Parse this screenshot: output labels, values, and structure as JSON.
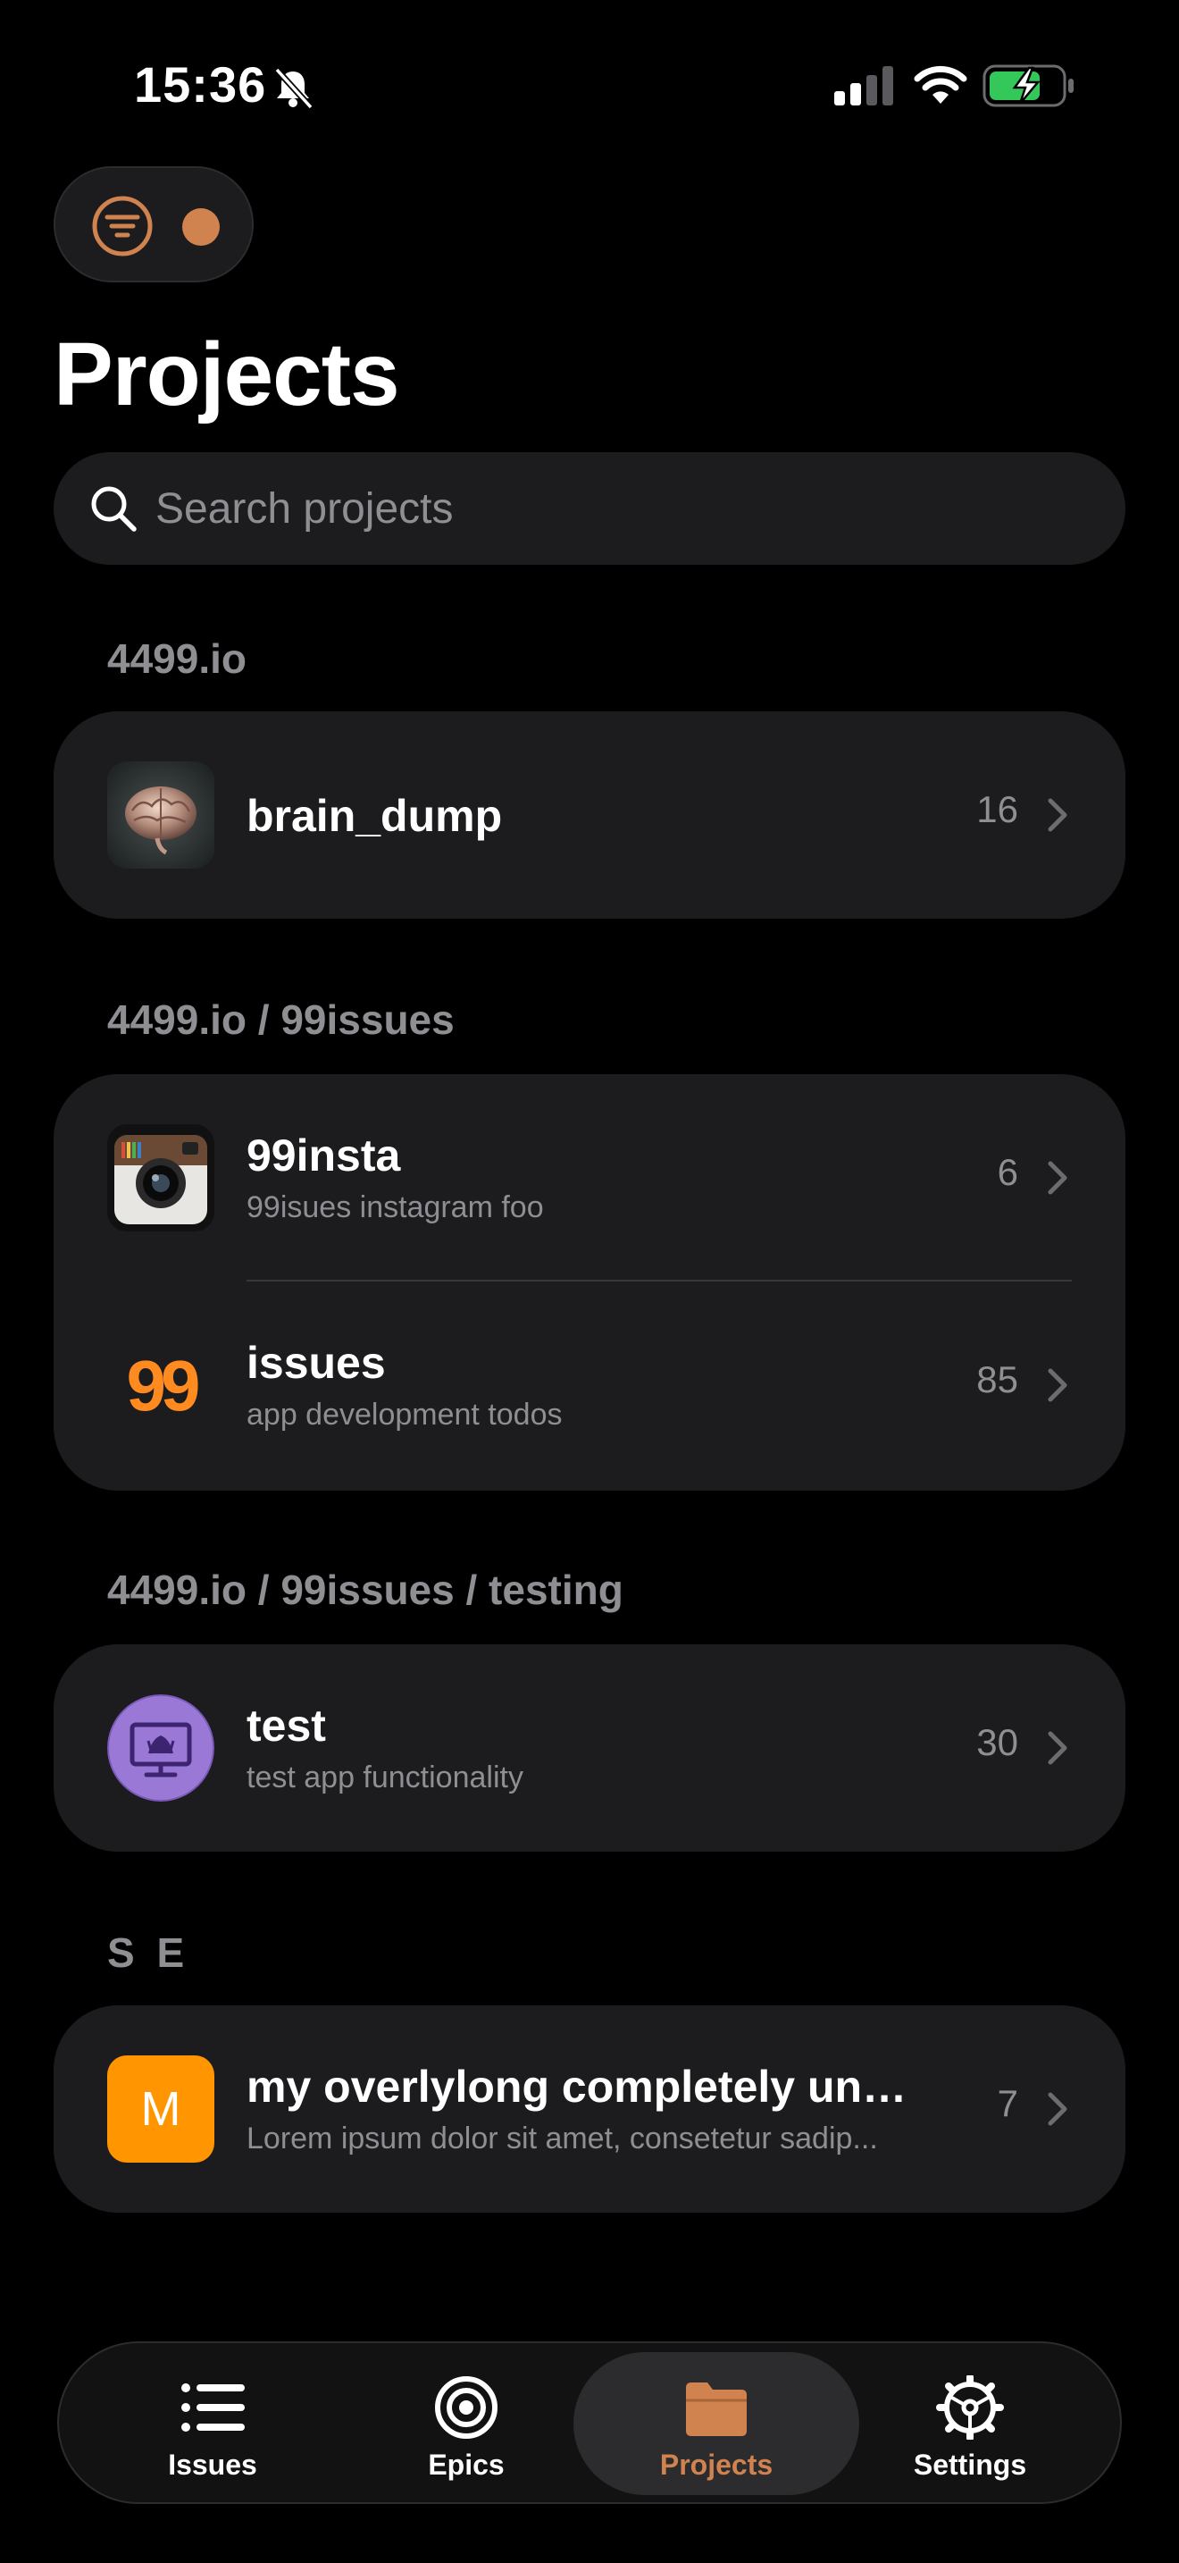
{
  "status_bar": {
    "time": "15:36"
  },
  "header": {
    "title": "Projects"
  },
  "search": {
    "placeholder": "Search projects"
  },
  "groups": [
    {
      "name": "4499.io",
      "projects": [
        {
          "name": "brain_dump",
          "description": "",
          "count": "16",
          "icon": "brain-image-icon"
        }
      ]
    },
    {
      "name": "4499.io / 99issues",
      "projects": [
        {
          "name": "99insta",
          "description": "99isues instagram foo",
          "count": "6",
          "icon": "instagram-camera-icon"
        },
        {
          "name": "issues",
          "description": "app development todos",
          "count": "85",
          "icon": "99-logo-icon"
        }
      ]
    },
    {
      "name": "4499.io / 99issues / testing",
      "projects": [
        {
          "name": "test",
          "description": "test app functionality",
          "count": "30",
          "icon": "monitor-icon"
        }
      ]
    },
    {
      "name": "S E",
      "projects": [
        {
          "name": "my overlylong completely unn...",
          "description": "Lorem ipsum dolor sit amet, consetetur sadip...",
          "count": "7",
          "icon": "letter-m-avatar",
          "avatar_letter": "M"
        }
      ]
    }
  ],
  "tabs": [
    {
      "label": "Issues",
      "icon": "list-icon",
      "active": false
    },
    {
      "label": "Epics",
      "icon": "target-icon",
      "active": false
    },
    {
      "label": "Projects",
      "icon": "folder-icon",
      "active": true
    },
    {
      "label": "Settings",
      "icon": "gear-icon",
      "active": false
    }
  ],
  "colors": {
    "accent": "#d0834f",
    "card": "#1c1c1e",
    "secondary_text": "#8e8e93",
    "avatar_orange": "#ff9500",
    "avatar_purple": "#9a78d6"
  }
}
